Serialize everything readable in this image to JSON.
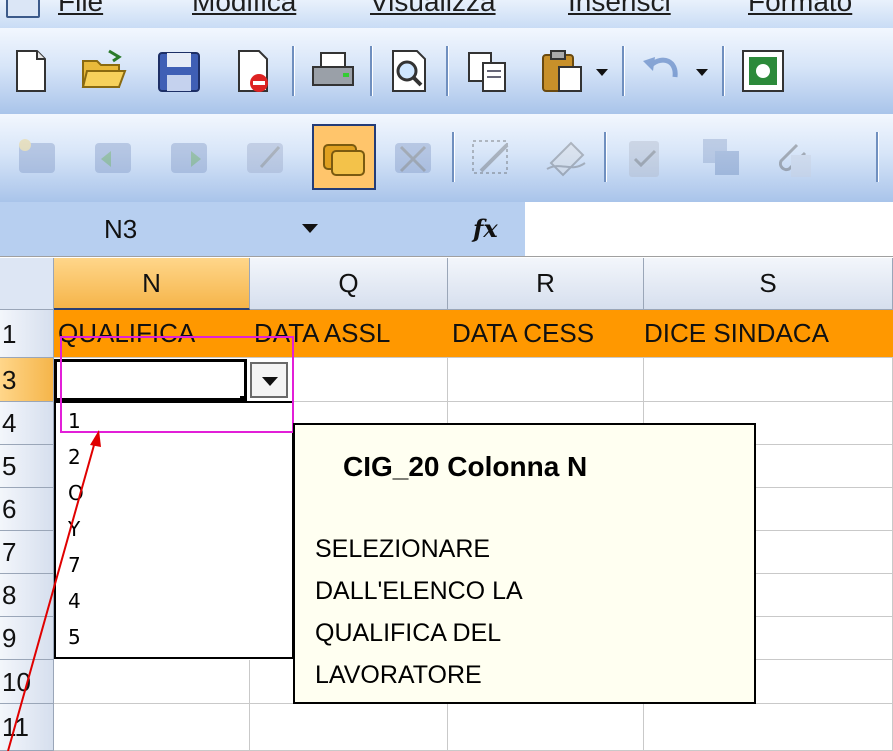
{
  "menubar": {
    "items": [
      "File",
      "Modifica",
      "Visualizza",
      "Inserisci",
      "Formato"
    ]
  },
  "toolbar_standard": {
    "buttons": [
      "new-document",
      "open-folder",
      "save",
      "permission",
      "print",
      "print-preview",
      "copy",
      "paste",
      "undo",
      "research"
    ]
  },
  "toolbar_reviewing": {
    "buttons": [
      "new-comment",
      "previous-comment",
      "next-comment",
      "show-comment",
      "show-all-comments",
      "delete-comment",
      "track-changes",
      "erase-ink",
      "accept-reject",
      "shared-workbook",
      "attach"
    ]
  },
  "formula_bar": {
    "name_box": "N3",
    "fx_label": "fx",
    "formula": ""
  },
  "grid": {
    "columns": [
      "N",
      "Q",
      "R",
      "S"
    ],
    "rows": [
      "1",
      "3",
      "4",
      "5",
      "6",
      "7",
      "8",
      "9",
      "10",
      "11"
    ],
    "header_row": [
      "QUALIFICA",
      "DATA ASSL",
      "DATA CESS",
      "DICE SINDACA"
    ]
  },
  "dropdown": {
    "options": [
      "1",
      "2",
      "O",
      "Y",
      "7",
      "4",
      "5"
    ]
  },
  "comment": {
    "title": "CIG_20   Colonna N",
    "lines": [
      "SELEZIONARE",
      "DALL'ELENCO LA",
      "QUALIFICA DEL",
      "LAVORATORE"
    ]
  },
  "colors": {
    "header_row_fill": "#ff9800",
    "highlight_box": "#e21fd8",
    "arrow": "#e00000",
    "active_toolbar_button": "#ffc56b",
    "selected_header": "#f5b54a"
  }
}
